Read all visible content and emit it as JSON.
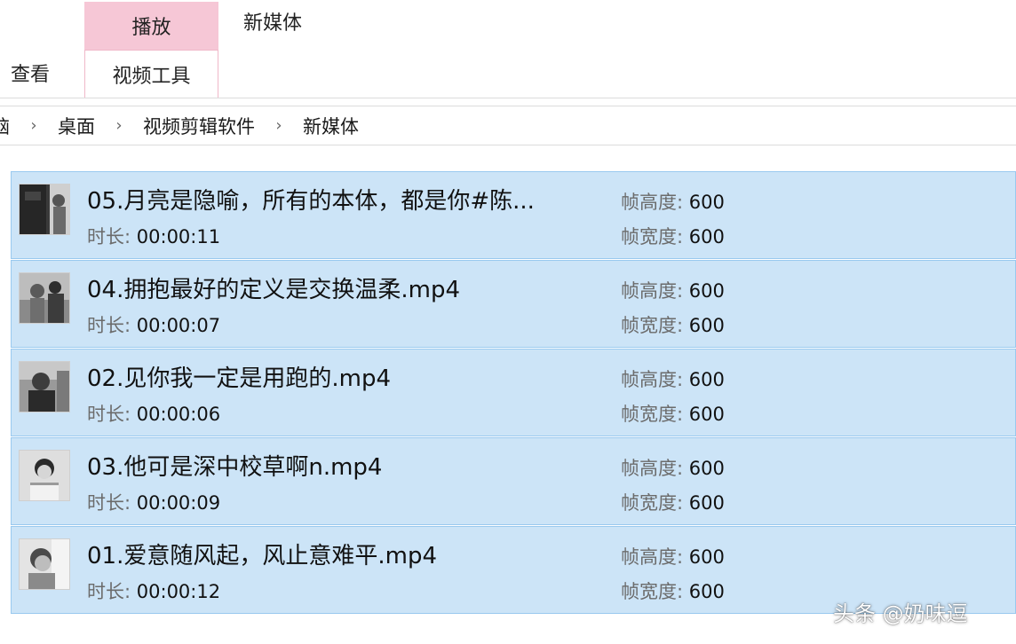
{
  "ribbon": {
    "context_group_label": "播放",
    "context_title": "新媒体",
    "tabs": [
      {
        "label": "查看"
      },
      {
        "label": "视频工具"
      }
    ]
  },
  "address_bar": {
    "crumbs": [
      "电脑",
      "桌面",
      "视频剪辑软件",
      "新媒体"
    ],
    "first_crumb_visible_text": "脑"
  },
  "property_labels": {
    "duration": "时长: ",
    "frame_height": "帧高度: ",
    "frame_width": "帧宽度: "
  },
  "files": [
    {
      "name": "05.月亮是隐喻，所有的本体，都是你#陈...",
      "duration": "00:00:11",
      "frame_height": "600",
      "frame_width": "600"
    },
    {
      "name": "04.拥抱最好的定义是交换温柔.mp4",
      "duration": "00:00:07",
      "frame_height": "600",
      "frame_width": "600"
    },
    {
      "name": "02.见你我一定是用跑的.mp4",
      "duration": "00:00:06",
      "frame_height": "600",
      "frame_width": "600"
    },
    {
      "name": "03.他可是深中校草啊n.mp4",
      "duration": "00:00:09",
      "frame_height": "600",
      "frame_width": "600"
    },
    {
      "name": "01.爱意随风起，风止意难平.mp4",
      "duration": "00:00:12",
      "frame_height": "600",
      "frame_width": "600"
    }
  ],
  "watermark": "头条 @奶味逗",
  "colors": {
    "selection_bg": "#cce4f7",
    "selection_border": "#99c9ef",
    "context_tab_bg": "#f6c7d6"
  }
}
